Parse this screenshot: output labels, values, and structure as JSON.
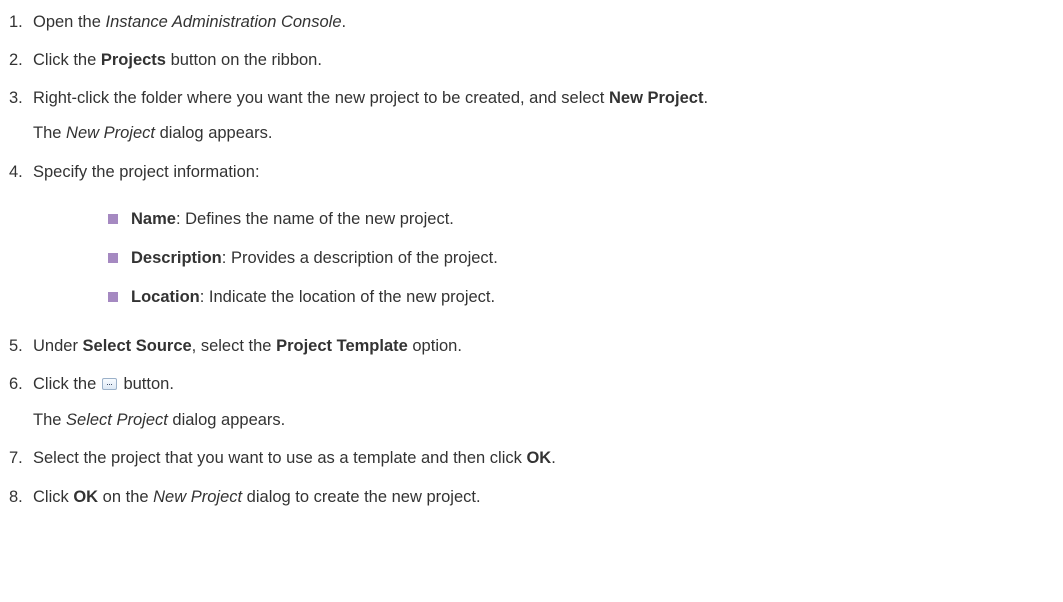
{
  "steps": [
    {
      "num": "1.",
      "pre": "Open the ",
      "em": "Instance Administration Console",
      "post": "."
    },
    {
      "num": "2.",
      "pre": "Click the ",
      "bold": "Projects",
      "post": " button on the ribbon."
    },
    {
      "num": "3.",
      "pre": "Right-click the folder where you want the new project to be created, and select ",
      "bold": "New Project",
      "post": ".",
      "result_em": "New Project",
      "result_pre": "The ",
      "result_post": " dialog appears."
    },
    {
      "num": "4.",
      "text": "Specify the project information:"
    },
    {
      "num": "5.",
      "pre": "Under ",
      "bold1": "Select Source",
      "mid": ", select the ",
      "bold2": "Project Template",
      "post": " option."
    },
    {
      "num": "6.",
      "pre": "Click the ",
      "post": " button.",
      "result_pre": "The ",
      "result_em": "Select Project",
      "result_post": " dialog appears."
    },
    {
      "num": "7.",
      "pre": "Select the project that you want to use as a template and then click ",
      "bold": "OK",
      "post": "."
    },
    {
      "num": "8.",
      "pre": "Click ",
      "bold": "OK",
      "mid": " on the ",
      "em": "New Project",
      "post": " dialog to create the new project."
    }
  ],
  "fields": [
    {
      "name": "Name",
      "desc": ": Defines the name of the new project."
    },
    {
      "name": "Description",
      "desc": ": Provides a description of the project."
    },
    {
      "name": "Location",
      "desc": ": Indicate the location of the new project."
    }
  ],
  "icons": {
    "browse_button": "ellipsis-button-icon",
    "bullet": "square-bullet-icon"
  },
  "colors": {
    "text": "#333333",
    "bullet": "#a589c1"
  }
}
